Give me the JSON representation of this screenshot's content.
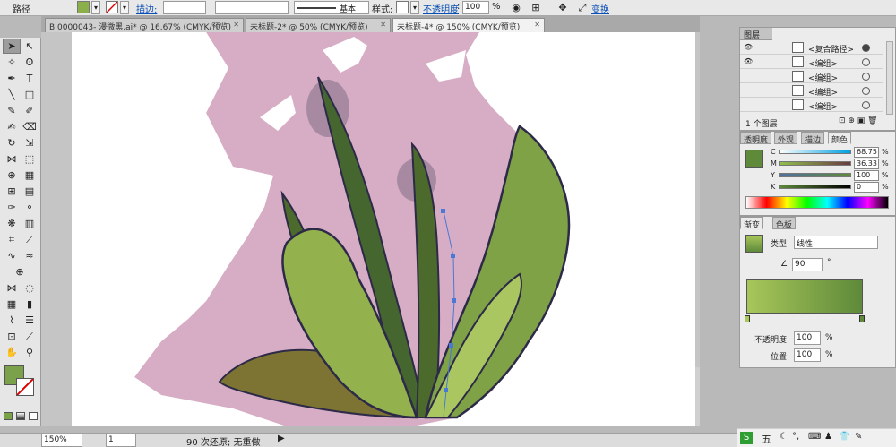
{
  "control_bar": {
    "object_type": "路径",
    "stroke_link": "描边:",
    "stroke_weight": "",
    "brush_field": "",
    "stroke_profile": "基本",
    "style_label": "样式:",
    "opacity_link": "不透明度",
    "opacity_colon": ":",
    "opacity_value": "100",
    "opacity_unit": "%",
    "transform_link": "变换"
  },
  "tabs": [
    {
      "label": "B 0000043- 漫微黑.ai* @ 16.67% (CMYK/预览)",
      "close": "✕"
    },
    {
      "label": "未标题-2* @ 50% (CMYK/预览)",
      "close": "✕"
    },
    {
      "label": "未标题-4* @ 150% (CMYK/预览)",
      "close": "✕"
    }
  ],
  "status_bar": {
    "zoom": "150%",
    "artboard": "1",
    "history": "90 次还原; 无重做"
  },
  "layers_panel": {
    "title": "图层",
    "items": [
      {
        "name": "<复合路径>"
      },
      {
        "name": "<编组>"
      },
      {
        "name": "<编组>"
      },
      {
        "name": "<编组>"
      },
      {
        "name": "<编组>"
      }
    ],
    "footer": "1 个图层"
  },
  "color_panel": {
    "tabs": [
      "透明度",
      "外观",
      "描边",
      "颜色"
    ],
    "channels": [
      {
        "label": "C",
        "value": "68.75",
        "level": 0.6875
      },
      {
        "label": "M",
        "value": "36.33",
        "level": 0.3633
      },
      {
        "label": "Y",
        "value": "100",
        "level": 1.0
      },
      {
        "label": "K",
        "value": "0",
        "level": 0.0
      }
    ],
    "percent": "%",
    "fill_color": "#5e8a3a"
  },
  "gradient_panel": {
    "tabs": [
      "渐变",
      "色板"
    ],
    "type_label": "类型:",
    "type_value": "线性",
    "angle": "90",
    "angle_unit": "°",
    "opacity_label": "不透明度:",
    "opacity_value": "100",
    "location_label": "位置:",
    "location_value": "100",
    "percent": "%",
    "start_color": "#a8c65a",
    "end_color": "#5e8a3a"
  },
  "taskbar": {
    "ime_label": "五"
  },
  "colors": {
    "pink_shadow": "#d6adc4",
    "leaf_light": "#a9c661",
    "leaf_dark": "#4c6a2c",
    "outline": "#2d2a48"
  }
}
